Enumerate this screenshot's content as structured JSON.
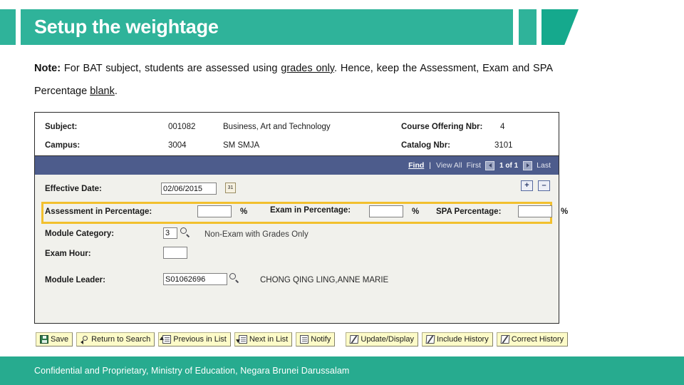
{
  "banner": {
    "title": "Setup the weightage",
    "accent_color": "#2fb39a",
    "accent_dark": "#15a98d"
  },
  "note": {
    "label": "Note:",
    "part1": " For BAT subject, students are assessed using ",
    "underline1": "grades only",
    "part2": ". Hence, keep the Assessment, Exam and SPA Percentage ",
    "underline2": "blank",
    "part3": "."
  },
  "summary": {
    "subject_label": "Subject:",
    "subject_code": "001082",
    "subject_desc": "Business, Art and Technology",
    "campus_label": "Campus:",
    "campus_code": "3004",
    "campus_desc": "SM SMJA",
    "course_offering_label": "Course Offering Nbr:",
    "course_offering_value": "4",
    "catalog_label": "Catalog Nbr:",
    "catalog_value": "3101"
  },
  "navbar": {
    "find": "Find",
    "separator": "|",
    "view_all": "View All",
    "first": "First",
    "count": "1 of 1",
    "last": "Last",
    "bg_color": "#4d5c8c"
  },
  "form": {
    "effective_date_label": "Effective Date:",
    "effective_date_value": "02/06/2015",
    "calendar_icon_text": "31",
    "add_row_label": "+",
    "delete_row_label": "–",
    "assessment_label": "Assessment in Percentage:",
    "assessment_value": "",
    "assessment_pct": "%",
    "exam_label": "Exam in Percentage:",
    "exam_value": "",
    "exam_pct": "%",
    "spa_label": "SPA Percentage:",
    "spa_value": "",
    "spa_pct": "%",
    "highlight_color": "#f2c02e",
    "module_category_label": "Module Category:",
    "module_category_value": "3",
    "module_category_desc": "Non-Exam with Grades Only",
    "exam_hour_label": "Exam Hour:",
    "exam_hour_value": "",
    "module_leader_label": "Module Leader:",
    "module_leader_value": "S01062696",
    "module_leader_name": "CHONG QING LING,ANNE MARIE"
  },
  "toolbar": {
    "save": "Save",
    "return_to_search": "Return to Search",
    "previous_in_list": "Previous in List",
    "next_in_list": "Next in List",
    "notify": "Notify",
    "update_display": "Update/Display",
    "include_history": "Include History",
    "correct_history": "Correct History"
  },
  "footer": {
    "text": "Confidential and Proprietary, Ministry of Education, Negara Brunei Darussalam",
    "bg_color": "#27ab8f"
  }
}
